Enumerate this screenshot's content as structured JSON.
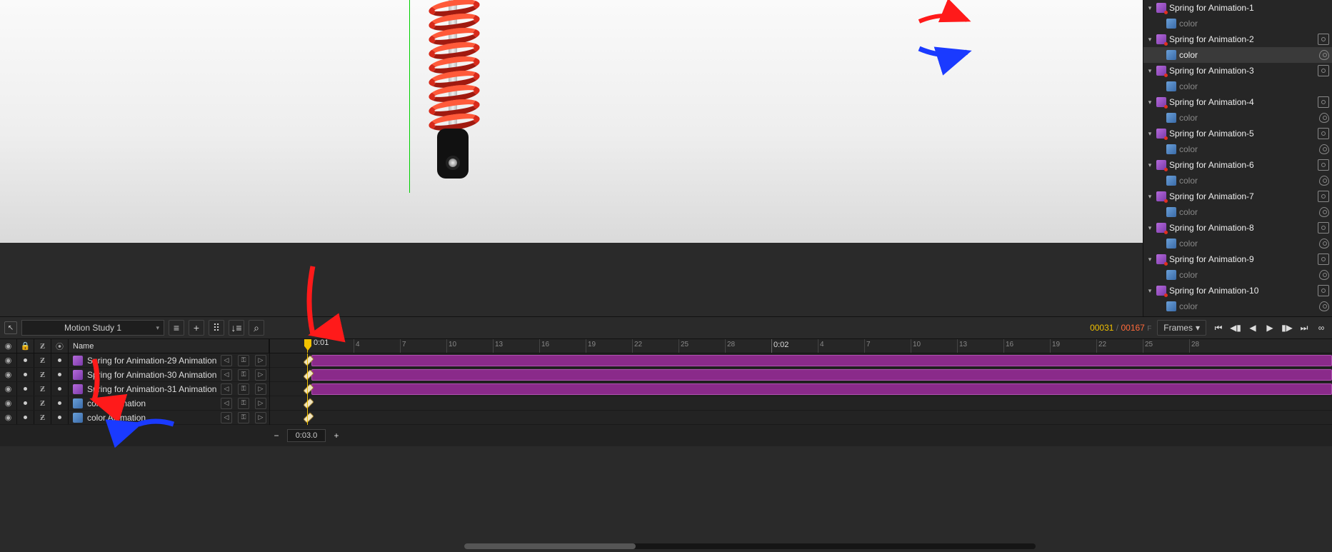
{
  "scene_tree": {
    "items": [
      {
        "name": "Spring for Animation-1",
        "child": "color",
        "focus": false,
        "eye": false
      },
      {
        "name": "Spring for Animation-2",
        "child": "color",
        "focus": true,
        "eye": true,
        "child_selected": true
      },
      {
        "name": "Spring for Animation-3",
        "child": "color",
        "focus": true,
        "eye": false
      },
      {
        "name": "Spring for Animation-4",
        "child": "color",
        "focus": true,
        "eye": true
      },
      {
        "name": "Spring for Animation-5",
        "child": "color",
        "focus": true,
        "eye": true
      },
      {
        "name": "Spring for Animation-6",
        "child": "color",
        "focus": true,
        "eye": true
      },
      {
        "name": "Spring for Animation-7",
        "child": "color",
        "focus": true,
        "eye": true
      },
      {
        "name": "Spring for Animation-8",
        "child": "color",
        "focus": true,
        "eye": true
      },
      {
        "name": "Spring for Animation-9",
        "child": "color",
        "focus": true,
        "eye": true
      },
      {
        "name": "Spring for Animation-10",
        "child": "color",
        "focus": true,
        "eye": true
      }
    ]
  },
  "timeline": {
    "study_name": "Motion Study 1",
    "name_header": "Name",
    "frame_current": "00031",
    "frame_total": "00167",
    "frame_suffix": "F",
    "units_label": "Frames",
    "time_input": "0:03.0",
    "playhead_label": "0:01",
    "second_marker": "0:02",
    "minor_ticks": [
      "4",
      "7",
      "10",
      "13",
      "16",
      "19",
      "22",
      "25",
      "28",
      "4",
      "7",
      "10",
      "13",
      "16",
      "19",
      "22",
      "25",
      "28"
    ],
    "tracks": [
      {
        "label": "Spring for Animation-29 Animation",
        "icon": "purple",
        "has_clip": true
      },
      {
        "label": "Spring for Animation-30 Animation",
        "icon": "purple",
        "has_clip": true
      },
      {
        "label": "Spring for Animation-31 Animation",
        "icon": "purple",
        "has_clip": true
      },
      {
        "label": "color Animation",
        "icon": "blue",
        "has_clip": false
      },
      {
        "label": "color Animation",
        "icon": "blue",
        "has_clip": false
      }
    ]
  },
  "glyphs": {
    "triangle_down": "▾",
    "triangle_right": "▸",
    "plus": "+",
    "minus": "−",
    "list": "≡",
    "grid": "⠿",
    "sort": "↓≡",
    "search": "⌕",
    "skip_first": "⏮",
    "prev_kf": "◀▮",
    "prev": "◀",
    "play": "▶",
    "next": "▮▶",
    "skip_last": "⏭",
    "loop": "∞",
    "eye": "👁",
    "lock": "🔒",
    "z": "Ƶ",
    "graph": "⦿",
    "key": "⚿",
    "step_l": "◁",
    "step_r": "▷"
  }
}
